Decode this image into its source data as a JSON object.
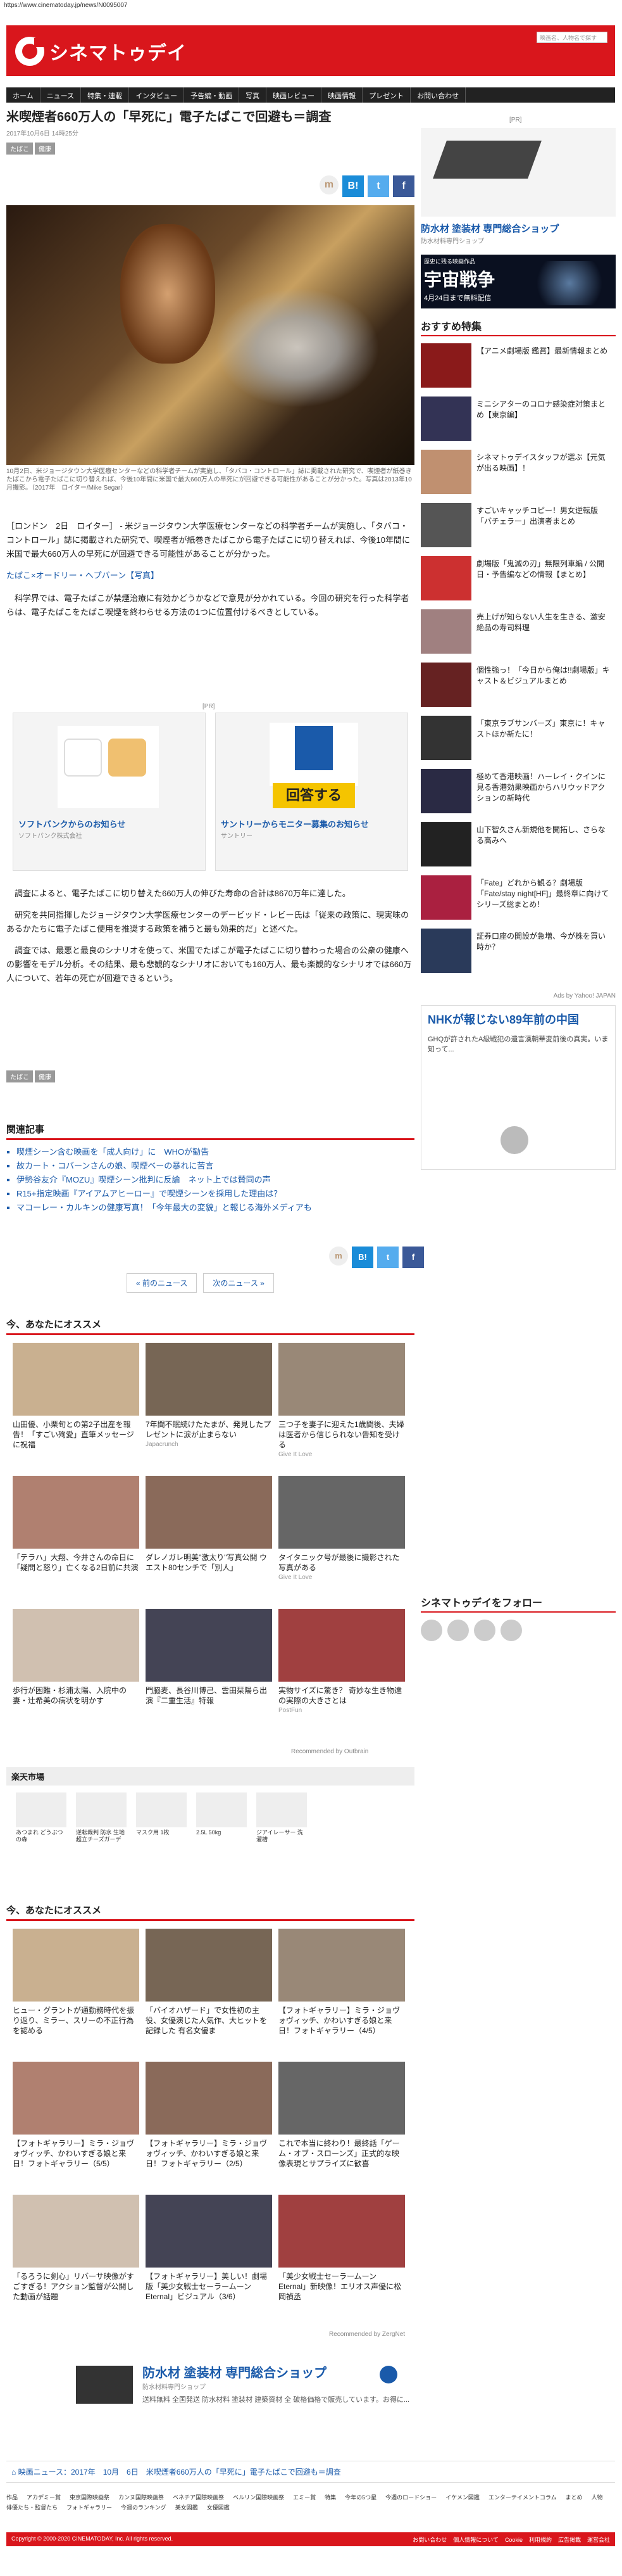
{
  "url": "https://www.cinematoday.jp/news/N0095007",
  "brand": {
    "logo_text": "シネマトゥデイ",
    "accent": "#d9161c"
  },
  "search": {
    "placeholder": "映画名、人物名で探す"
  },
  "nav": [
    "ホーム",
    "ニュース",
    "特集・連載",
    "インタビュー",
    "予告編・動画",
    "写真",
    "映画レビュー",
    "映画情報",
    "プレゼント",
    "お問い合わせ"
  ],
  "article": {
    "title": "米喫煙者660万人の「早死に」電子たばこで回避も＝調査",
    "meta": "2017年10月6日 14時25分",
    "tags": [
      "たばこ",
      "健康"
    ],
    "caption": "10月2日、米ジョージタウン大学医療センターなどの科学者チームが実施し、「タバコ・コントロール」誌に掲載された研究で、喫煙者が紙巻きたばこから電子たばこに切り替えれば、今後10年間に米国で最大660万人の早死にが回避できる可能性があることが分かった。写真は2013年10月撮影。（2017年　ロイター/Mike Segar）",
    "p1": "［ロンドン　2日　ロイター］ - 米ジョージタウン大学医療センターなどの科学者チームが実施し、「タバコ・コントロール」誌に掲載された研究で、喫煙者が紙巻きたばこから電子たばこに切り替えれば、今後10年間に米国で最大660万人の早死にが回避できる可能性があることが分かった。",
    "p_link": "たばこ×オードリー・ヘプバーン【写真】",
    "p2": "科学界では、電子たばこが禁煙治療に有効かどうかなどで意見が分かれている。今回の研究を行った科学者らは、電子たばこをたばこ喫煙を終わらせる方法の1つに位置付けるべきとしている。",
    "p3": "調査によると、電子たばこに切り替えた660万人の伸びた寿命の合計は8670万年に達した。",
    "p4": "研究を共同指揮したジョージタウン大学医療センターのデービッド・レビー氏は「従来の政策に、現実味のあるかたちに電子たばこ使用を推奨する政策を補うと最も効果的だ」と述べた。",
    "p5": "調査では、最悪と最良のシナリオを使って、米国でたばこが電子たばこに切り替わった場合の公衆の健康への影響をモデル分析。その結果、最も悲観的なシナリオにおいても160万人、最も楽観的なシナリオでは660万人について、若年の死亡が回避できるという。"
  },
  "ads": [
    {
      "title": "ソフトバンクからのお知らせ",
      "sub": "ソフトバンク株式会社",
      "label": "[PR]"
    },
    {
      "title": "サントリーからモニター募集のお知らせ",
      "sub": "サントリー",
      "badge": "回答する"
    }
  ],
  "related": {
    "heading": "関連記事",
    "items": [
      "喫煙シーン含む映画を「成人向け」に　WHOが勧告",
      "故カート・コバーンさんの娘、喫煙ベーの暴れに苦言",
      "伊勢谷友介『MOZU』喫煙シーン批判に反論　ネット上では賛同の声",
      "R15+指定映画『アイアムアヒーロー』で喫煙シーンを採用した理由は？",
      "マコーレー・カルキンの健康写真！「今年最大の変貌」と報じる海外メディアも"
    ]
  },
  "pager": {
    "prev": "« 前のニュース",
    "next": "次のニュース »"
  },
  "rec1": {
    "heading": "今、あなたにオススメ",
    "items": [
      {
        "t": "山田優、小栗旬との第2子出産を報告！「すごい殉愛」直筆メッセージに祝福",
        "s": ""
      },
      {
        "t": "7年間不眠続けたたまが、発見したプレゼントに涙が止まらない",
        "s": "Japacrunch"
      },
      {
        "t": "三つ子を妻子に迎えた1歳間後、夫婦は医者から信じられない告知を受ける",
        "s": "Give It Love"
      },
      {
        "t": "「テラハ」大翔、今井さんの命日に「疑問と怒り」亡くなる2日前に共演",
        "s": ""
      },
      {
        "t": "ダレノガレ明美\"激太り\"写真公開 ウエスト80センチで「別人」",
        "s": ""
      },
      {
        "t": "タイタニック号が最後に撮影された写真がある",
        "s": "Give It Love"
      },
      {
        "t": "歩行が困難・杉浦太陽、入院中の妻・辻希美の病状を明かす",
        "s": ""
      },
      {
        "t": "門脇麦、長谷川博己、雲田栞陽ら出演『二重生活』特報",
        "s": ""
      },
      {
        "t": "実物サイズに驚き？ 奇妙な生き物達の実際の大きさとは",
        "s": "PostFun"
      }
    ],
    "recby": "Recommended by Outbrain"
  },
  "market": {
    "heading": "楽天市場",
    "items": [
      "あつまれ どうぶつの森",
      "逆転裁判 防水 生地 超立チーズガーデ",
      "マスク用 1枚",
      "2.5L 50kg",
      "ジアイレーサー 洗濯槽"
    ]
  },
  "rec2": {
    "heading": "今、あなたにオススメ",
    "items": [
      {
        "t": "ヒュー・グラントが通勤務時代を振り返り、ミラー、スリーの不正行為を認める"
      },
      {
        "t": "「バイオハザード」で女性初の主役、女優演じた人気作、大ヒットを記録した 有名女優ま"
      },
      {
        "t": "【フォトギャラリー】ミラ・ジョヴォヴィッチ、かわいすぎる娘と来日！フォトギャラリー（4/5）"
      },
      {
        "t": "【フォトギャラリー】ミラ・ジョヴォヴィッチ、かわいすぎる娘と来日！フォトギャラリー（5/5）"
      },
      {
        "t": "【フォトギャラリー】ミラ・ジョヴォヴィッチ、かわいすぎる娘と来日！フォトギャラリー（2/5）"
      },
      {
        "t": "これで本当に終わり！最終話「ゲーム・オブ・スローンズ」正式的な映像表現とサプライズに歓喜"
      },
      {
        "t": "「るろうに剣心」リバーサ映像がすごすぎる！アクション監督が公開した動画が話題"
      },
      {
        "t": "【フォトギャラリー】美しい！劇場版「美少女戦士セーラームーン Eternal」ビジュアル（3/6）"
      },
      {
        "t": "「美少女戦士セーラームーン Eternal」新映像！エリオス声優に松岡禎丞"
      }
    ],
    "recby": "Recommended by ZergNet"
  },
  "bottom_ad": {
    "title": "防水材 塗装材 専門総合ショップ",
    "sub": "防水材料専門ショップ",
    "desc": "送料無料 全国発送 防水材料 塗装材 建築資材 全 破格価格で販売しています。お得に..."
  },
  "breadcrumb": "映画ニュース：2017年　10月　6日　米喫煙者660万人の「早死に」電子たばこで回避も＝調査",
  "footer_links": [
    "作品",
    "アカデミー賞",
    "東京国際映画祭",
    "カンヌ国際映画祭",
    "ベネチア国際映画祭",
    "ベルリン国際映画祭",
    "エミー賞",
    "特集",
    "今年の5つ星",
    "今週のロードショー",
    "イケメン図鑑",
    "エンターテイメントコラム",
    "まとめ",
    "人物",
    "俳優たち・監督たち",
    "フォトギャラリー",
    "今週のランキング",
    "美女図鑑",
    "女優図鑑"
  ],
  "copyright": "Copyright © 2000-2020 CINEMATODAY, Inc. All rights reserved.",
  "footer_right": [
    "お問い合わせ",
    "個人情報について",
    "Cookie",
    "利用規約",
    "広告掲載",
    "運営会社"
  ],
  "sidebar": {
    "pr_label": "[PR]",
    "ad1_title": "防水材 塗装材 専門総合ショップ",
    "ad1_sub": "防水材料専門ショップ",
    "banner_small": "歴史に残る映画作品",
    "banner_title": "宇宙戦争",
    "banner_date": "4月24日まで無料配信",
    "special_heading": "おすすめ特集",
    "specials": [
      "【アニメ劇場版 鑑賞】最新情報まとめ",
      "ミニシアターのコロナ感染症対策まとめ【東京編】",
      "シネマトゥデイスタッフが選ぶ【元気が出る映画】！",
      "すごいキャッチコピー！男女逆転版「バチェラー」出演者まとめ",
      "劇場版「鬼滅の刃」無限列車編 / 公開日・予告編などの情報【まとめ】",
      "売上げが知らない人生を生きる、激安絶品の寿司料理",
      "個性強っ！「今日から俺は!!劇場版」キャスト＆ビジュアルまとめ",
      "「東京ラブサンバーズ」東京に！キャストほか新たに！",
      "極めて香港映画！ハーレイ・クインに見る香港効果映画からハリウッドアクションの新時代",
      "山下智久さん新規他を開拓し、さらなる高みへ",
      "「Fate」どれから観る？劇場版「Fate/stay night[HF]」最終章に向けてシリーズ総まとめ！",
      "証券口座の開設が急増、今が株を買い時か？"
    ],
    "ads_by": "Ads by Yahoo! JAPAN",
    "nhk_title": "NHKが報じない89年前の中国",
    "nhk_sub": "GHQが許されたA級戦犯の遺言漢朝華変前後の真実。いま知って...",
    "follow_heading": "シネマトゥデイをフォロー"
  }
}
